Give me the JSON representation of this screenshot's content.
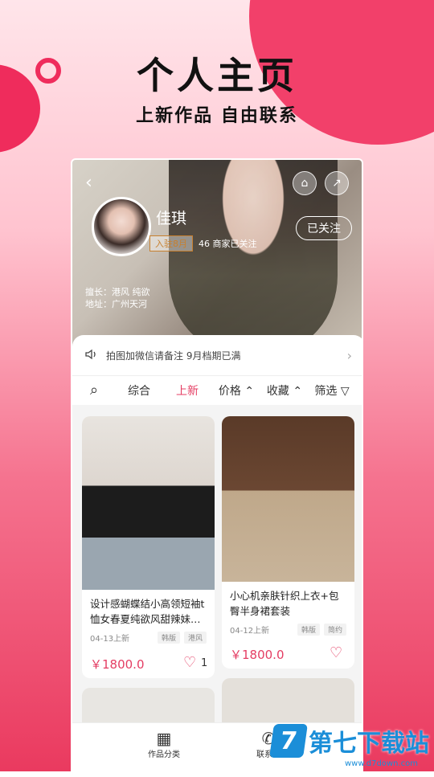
{
  "hero": {
    "title": "个人主页",
    "subtitle": "上新作品  自由联系"
  },
  "profile": {
    "name": "佳琪",
    "joined": "入驻8月",
    "fans": "46 商家已关注",
    "follow": "已关注",
    "specialty": "擅长：港风 纯欲",
    "address": "地址：广州天河"
  },
  "notice": {
    "text": "拍图加微信请备注 9月档期已满"
  },
  "filters": {
    "search": "⌕",
    "all": "综合",
    "new": "上新",
    "price": "价格 ⌃",
    "fav": "收藏 ⌃",
    "filter": "筛选 ▽"
  },
  "products": [
    {
      "title": "设计感蝴蝶结小高领短袖t恤女春夏纯欲风甜辣妹…",
      "date": "04-13上新",
      "tags": [
        "韩版",
        "港风"
      ],
      "price": "￥1800.0",
      "likes": "1"
    },
    {
      "title": "小心机亲肤针织上衣+包臀半身裙套装",
      "date": "04-12上新",
      "tags": [
        "韩版",
        "简约"
      ],
      "price": "￥1800.0",
      "likes": ""
    }
  ],
  "bottom": {
    "category": "作品分类",
    "contact": "联系我"
  },
  "watermark": {
    "brand": "第七下载站",
    "url": "www.d7down.com"
  },
  "colors": {
    "accent": "#e43d63",
    "brand": "#ef2c5c"
  }
}
